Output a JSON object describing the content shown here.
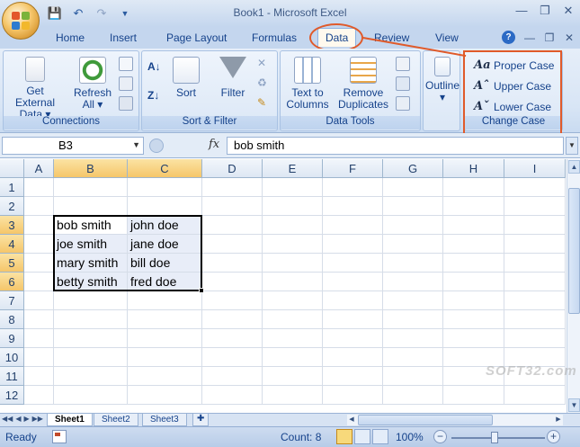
{
  "window": {
    "title": "Book1 - Microsoft Excel"
  },
  "quick_access": [
    {
      "icon": "save-icon"
    },
    {
      "icon": "undo-icon"
    },
    {
      "icon": "redo-icon"
    },
    {
      "icon": "customize-qat-icon"
    }
  ],
  "tabs": [
    {
      "label": "Home",
      "active": false
    },
    {
      "label": "Insert",
      "active": false
    },
    {
      "label": "Page Layout",
      "active": false
    },
    {
      "label": "Formulas",
      "active": false
    },
    {
      "label": "Data",
      "active": true
    },
    {
      "label": "Review",
      "active": false
    },
    {
      "label": "View",
      "active": false
    }
  ],
  "ribbon": {
    "get_external_data": {
      "line1": "Get External",
      "line2": "Data ▾"
    },
    "refresh_all": {
      "line1": "Refresh",
      "line2": "All ▾"
    },
    "connections_group": "Connections",
    "sort": "Sort",
    "filter": "Filter",
    "sort_filter_group": "Sort & Filter",
    "text_to_columns": {
      "line1": "Text to",
      "line2": "Columns"
    },
    "remove_duplicates": {
      "line1": "Remove",
      "line2": "Duplicates"
    },
    "data_tools_group": "Data Tools",
    "outline": {
      "line1": "Outline",
      "line2": "▾"
    },
    "change_case": {
      "proper": "Proper Case",
      "upper": "Upper Case",
      "lower": "Lower Case",
      "group": "Change Case"
    }
  },
  "formula_bar": {
    "name_box": "B3",
    "fx": "fx",
    "value": "bob smith"
  },
  "grid": {
    "columns": [
      "A",
      "B",
      "C",
      "D",
      "E",
      "F",
      "G",
      "H",
      "I"
    ],
    "rows": [
      "1",
      "2",
      "3",
      "4",
      "5",
      "6",
      "7",
      "8",
      "9",
      "10",
      "11",
      "12"
    ],
    "selected_columns": [
      "B",
      "C"
    ],
    "selected_rows": [
      "3",
      "4",
      "5",
      "6"
    ],
    "cells": [
      {
        "ref": "B3",
        "value": "bob smith"
      },
      {
        "ref": "C3",
        "value": "john doe"
      },
      {
        "ref": "B4",
        "value": "joe smith"
      },
      {
        "ref": "C4",
        "value": "jane doe"
      },
      {
        "ref": "B5",
        "value": "mary smith"
      },
      {
        "ref": "C5",
        "value": "bill doe"
      },
      {
        "ref": "B6",
        "value": "betty smith"
      },
      {
        "ref": "C6",
        "value": "fred doe"
      }
    ]
  },
  "sheets": [
    {
      "label": "Sheet1",
      "active": true
    },
    {
      "label": "Sheet2",
      "active": false
    },
    {
      "label": "Sheet3",
      "active": false
    }
  ],
  "status": {
    "ready": "Ready",
    "count": "Count: 8",
    "zoom": "100%"
  },
  "watermark": "SOFT32.com",
  "colors": {
    "highlight": "#e05a2a",
    "selected_header": "#f5c66a"
  }
}
